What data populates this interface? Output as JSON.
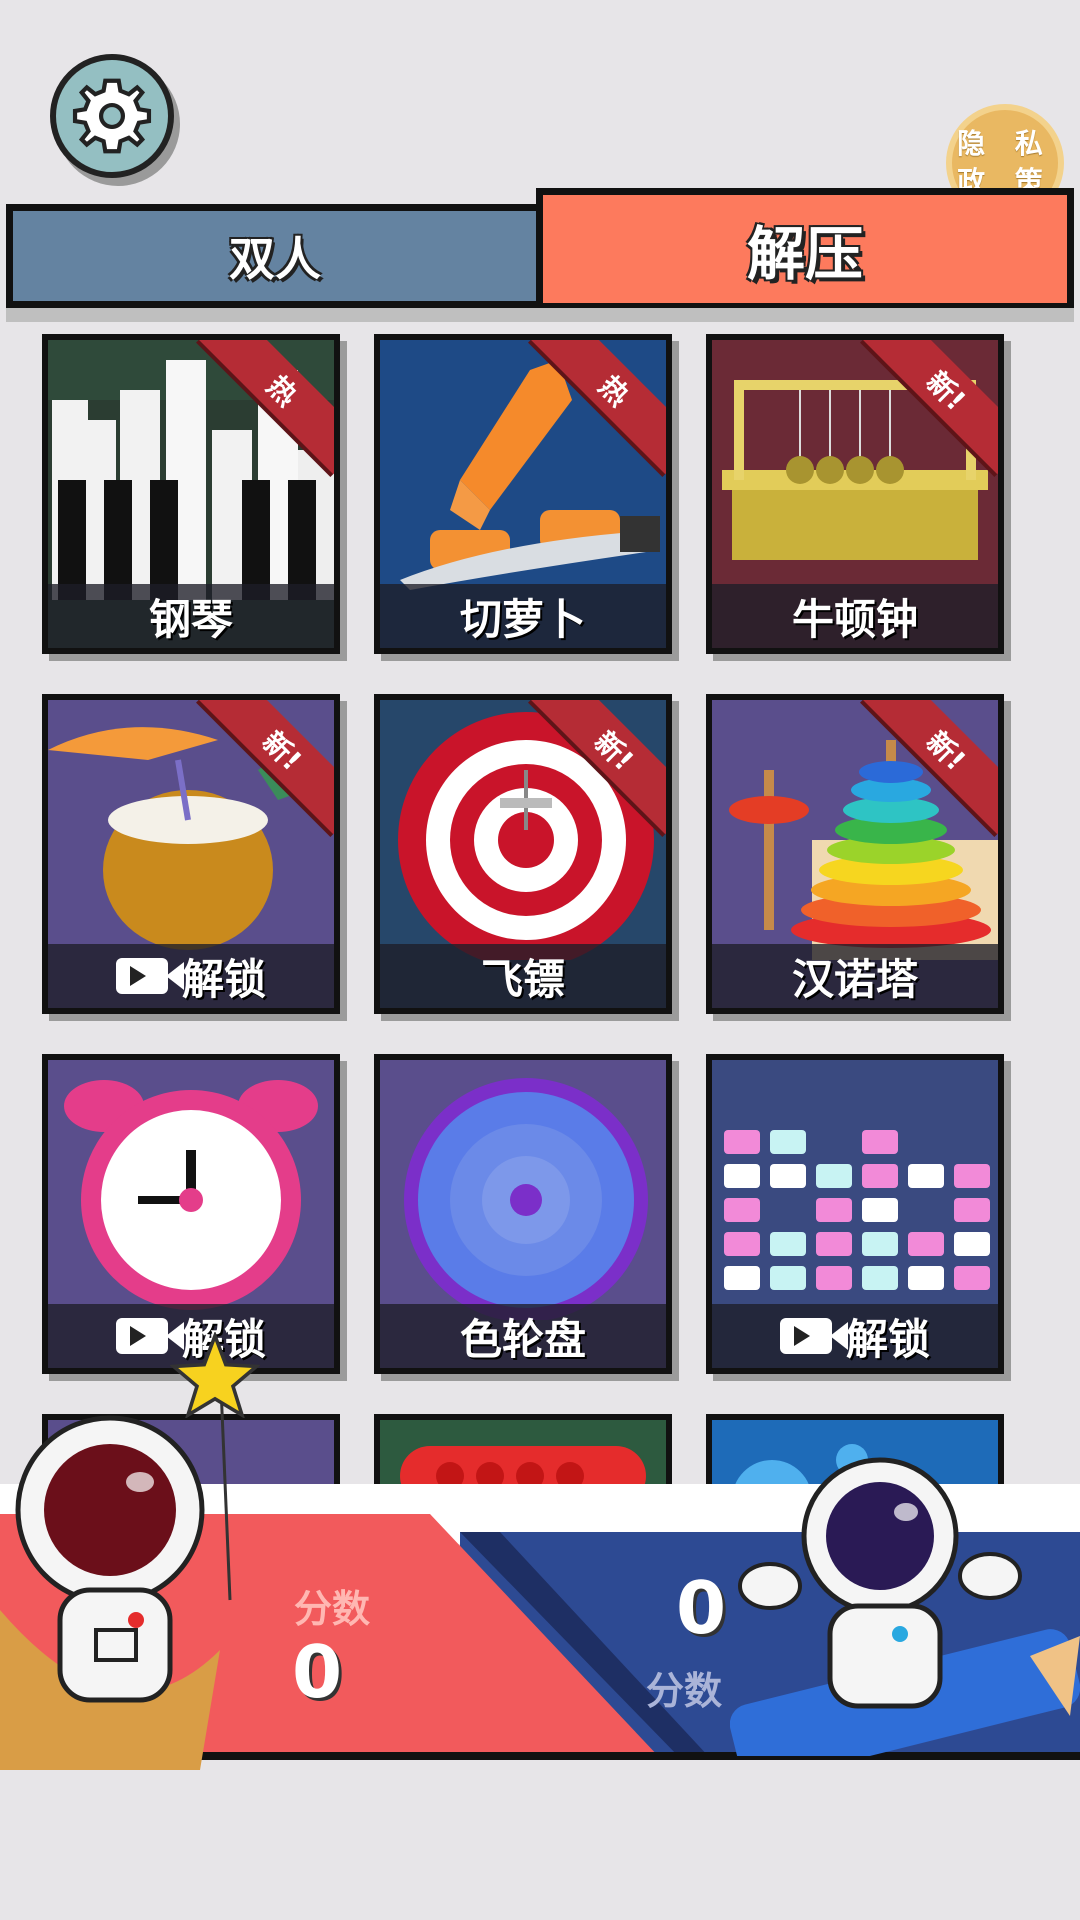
{
  "privacy": {
    "line1": "隐 私",
    "line2": "政 策"
  },
  "tabs": {
    "duo": "双人",
    "relax": "解压"
  },
  "games": [
    {
      "name": "钢琴",
      "badge": "热",
      "locked": false
    },
    {
      "name": "切萝卜",
      "badge": "热",
      "locked": false
    },
    {
      "name": "牛顿钟",
      "badge": "新!",
      "locked": false
    },
    {
      "name": "解锁",
      "badge": "新!",
      "locked": true
    },
    {
      "name": "飞镖",
      "badge": "新!",
      "locked": false
    },
    {
      "name": "汉诺塔",
      "badge": "新!",
      "locked": false
    },
    {
      "name": "解锁",
      "badge": "",
      "locked": true
    },
    {
      "name": "色轮盘",
      "badge": "",
      "locked": false
    },
    {
      "name": "解锁",
      "badge": "",
      "locked": true
    }
  ],
  "scores": {
    "player1": {
      "label": "分数",
      "value": "0"
    },
    "player2": {
      "label": "分数",
      "value": "0"
    }
  },
  "colors": {
    "tab_duo": "#6483a1",
    "tab_relax": "#fd7a5d",
    "score_left": "#f25a5c",
    "score_right": "#2d4a93"
  },
  "icons": [
    "gear-icon",
    "video-icon",
    "star-icon",
    "astronaut-icon"
  ]
}
